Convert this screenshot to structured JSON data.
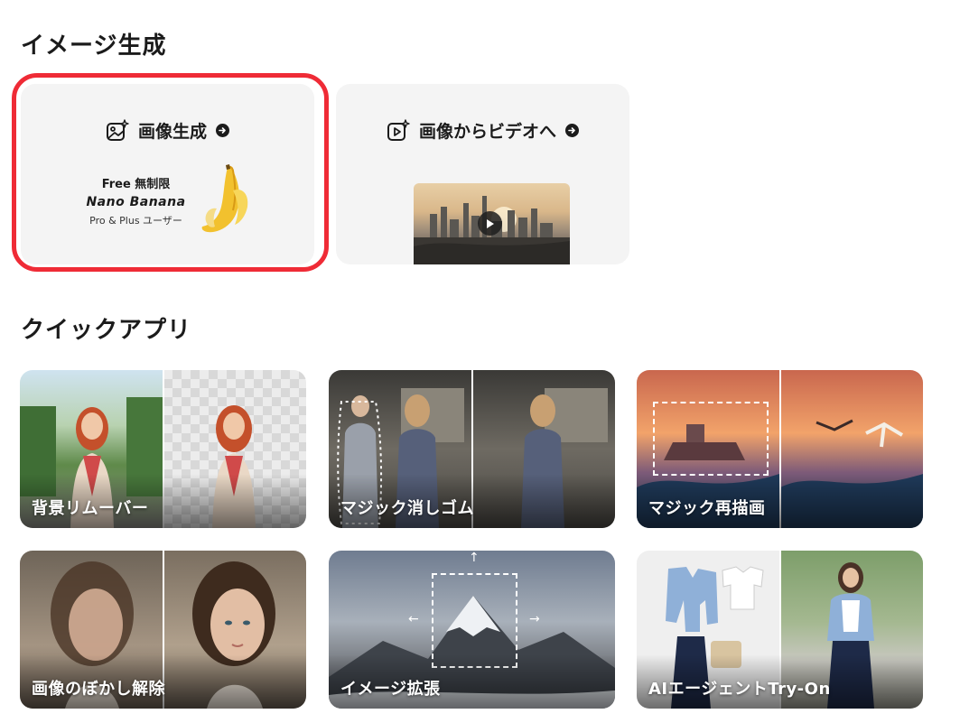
{
  "sections": {
    "image_generation_title": "イメージ生成",
    "quick_apps_title": "クイックアプリ"
  },
  "gen_cards": {
    "image_gen": {
      "label": "画像生成",
      "promo_free": "Free 無制限",
      "promo_model": "Nano Banana",
      "promo_users": "Pro & Plus ユーザー"
    },
    "image_to_video": {
      "label": "画像からビデオへ"
    }
  },
  "quick_apps": [
    {
      "label": "背景リムーバー"
    },
    {
      "label": "マジック消しゴム"
    },
    {
      "label": "マジック再描画"
    },
    {
      "label": "画像のぼかし解除"
    },
    {
      "label": "イメージ拡張"
    },
    {
      "label": "AIエージェントTry-On"
    }
  ],
  "colors": {
    "highlight": "#ef2b36",
    "card_bg": "#f4f4f4",
    "text": "#1b1b1b"
  },
  "icons": {
    "image_gen": "image-sparkle-icon",
    "image_to_video": "video-sparkle-icon",
    "arrow": "arrow-right-circle-icon",
    "play": "play-icon"
  }
}
